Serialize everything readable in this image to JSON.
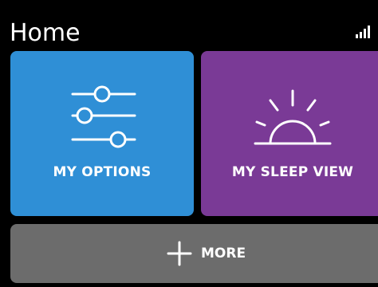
{
  "header": {
    "title": "Home",
    "status_icon": "signal-strength-icon"
  },
  "tiles": {
    "options": {
      "label": "MY OPTIONS",
      "icon": "sliders-icon",
      "color": "#2f8fd6"
    },
    "sleep": {
      "label": "MY SLEEP VIEW",
      "icon": "sunrise-icon",
      "color": "#7a3a96"
    },
    "more": {
      "label": "MORE",
      "icon": "plus-icon",
      "color": "#6c6c6c"
    }
  }
}
